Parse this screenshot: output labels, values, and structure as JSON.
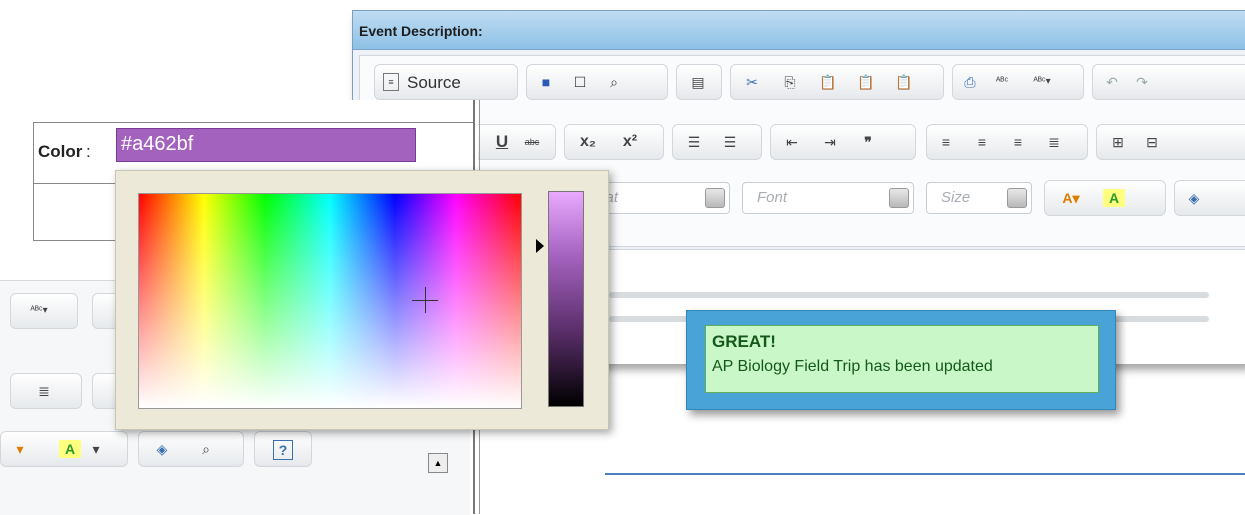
{
  "editor": {
    "title": "Event Description:",
    "source_label": "Source",
    "combos": {
      "format": "mat",
      "font": "Font",
      "size": "Size"
    }
  },
  "color_field": {
    "label": "Color",
    "colon": ":",
    "value": "#a462bf"
  },
  "notification": {
    "title": "GREAT!",
    "message": "AP Biology Field Trip has been updated"
  },
  "colors": {
    "selected": "#a462bf",
    "notify_bg": "#c9f7c7",
    "notify_frame": "#4aa3d6",
    "editor_header": "#8ec1e6"
  }
}
